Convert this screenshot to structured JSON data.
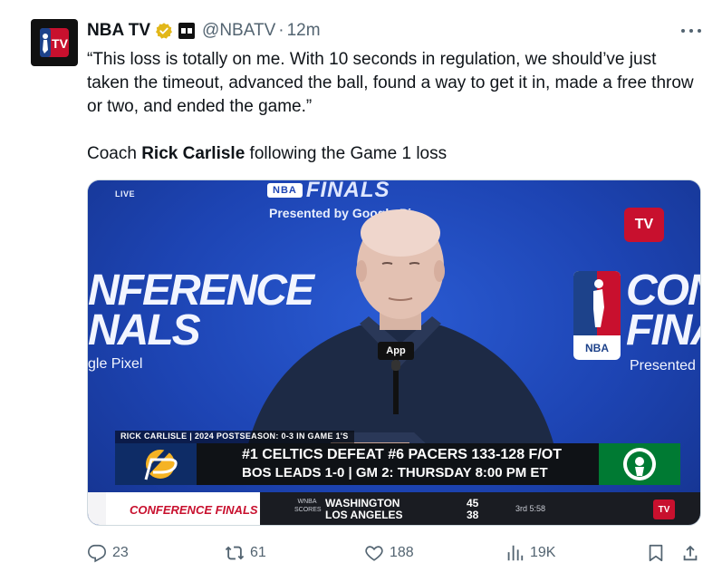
{
  "tweet": {
    "author_name": "NBA TV",
    "handle": "@NBATV",
    "separator": "·",
    "time": "12m",
    "quote": "“This loss is totally on me. With 10 seconds in regulation, we should’ve just taken the timeout, advanced the ball, found a way to get it in, made a free throw or two, and ended the game.”",
    "caption_prefix": "Coach ",
    "caption_bold": "Rick Carlisle",
    "caption_suffix": " following the Game 1 loss"
  },
  "media": {
    "live_label": "LIVE",
    "finals_pill": "NBA",
    "finals_word": "FINALS",
    "presented_top": "Presented by Google Pi",
    "conf_left_1": "NFERENCE",
    "conf_left_2": "NALS",
    "conf_left_pixel": "gle Pixel",
    "conf_right_1": "CONF",
    "conf_right_2": "FINAL",
    "conf_right_pixel": "Presented by Google P",
    "nba_logo_text": "NBA",
    "tv_logo_text": "TV",
    "mic_label": "App",
    "lower_caption": "RICK CARLISLE | 2024 POSTSEASON: 0-3 IN GAME 1'S",
    "score_line": "#1 CELTICS DEFEAT #6 PACERS 133-128 F/OT",
    "lead_line": "BOS LEADS 1-0  |  GM 2: THURSDAY 8:00 PM ET",
    "ticker_brand": "CONFERENCE FINALS",
    "ticker_label": "WNBA SCORES",
    "ticker_team_1": "WASHINGTON",
    "ticker_team_2": "LOS ANGELES",
    "ticker_score_1": "45",
    "ticker_score_2": "38",
    "ticker_clock": "3rd 5:58",
    "ticker_tv": "TV"
  },
  "actions": {
    "replies": "23",
    "reposts": "61",
    "likes": "188",
    "views": "19K"
  },
  "colors": {
    "text": "#0f1419",
    "secondary": "#536471",
    "verified_gold": "#e2b719",
    "nba_red": "#c8102e",
    "nba_blue": "#1d428a"
  },
  "icons": [
    "nbatv-avatar-icon",
    "verified-badge-icon",
    "affiliate-badge-icon",
    "more-icon",
    "reply-icon",
    "repost-icon",
    "like-icon",
    "views-icon",
    "bookmark-icon",
    "share-icon"
  ]
}
